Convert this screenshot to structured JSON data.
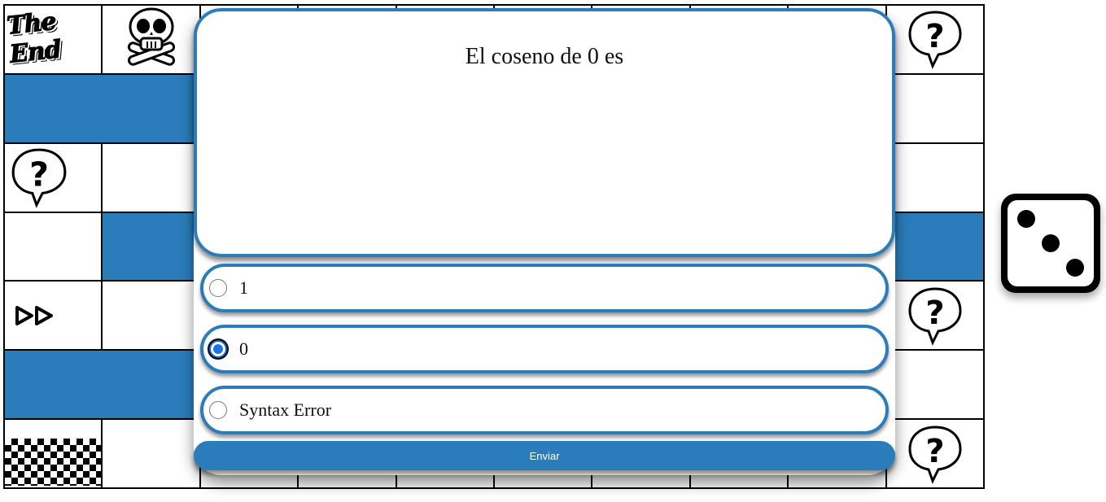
{
  "board": {
    "end_label": "The End"
  },
  "die": {
    "value": 3
  },
  "quiz": {
    "question": "El coseno de 0 es",
    "options": [
      {
        "label": "1",
        "selected": false
      },
      {
        "label": "0",
        "selected": true
      },
      {
        "label": "Syntax Error",
        "selected": false
      }
    ],
    "submit_label": "Enviar"
  },
  "colors": {
    "accent": "#2a7dba",
    "radio_selected": "#1a73e8"
  }
}
